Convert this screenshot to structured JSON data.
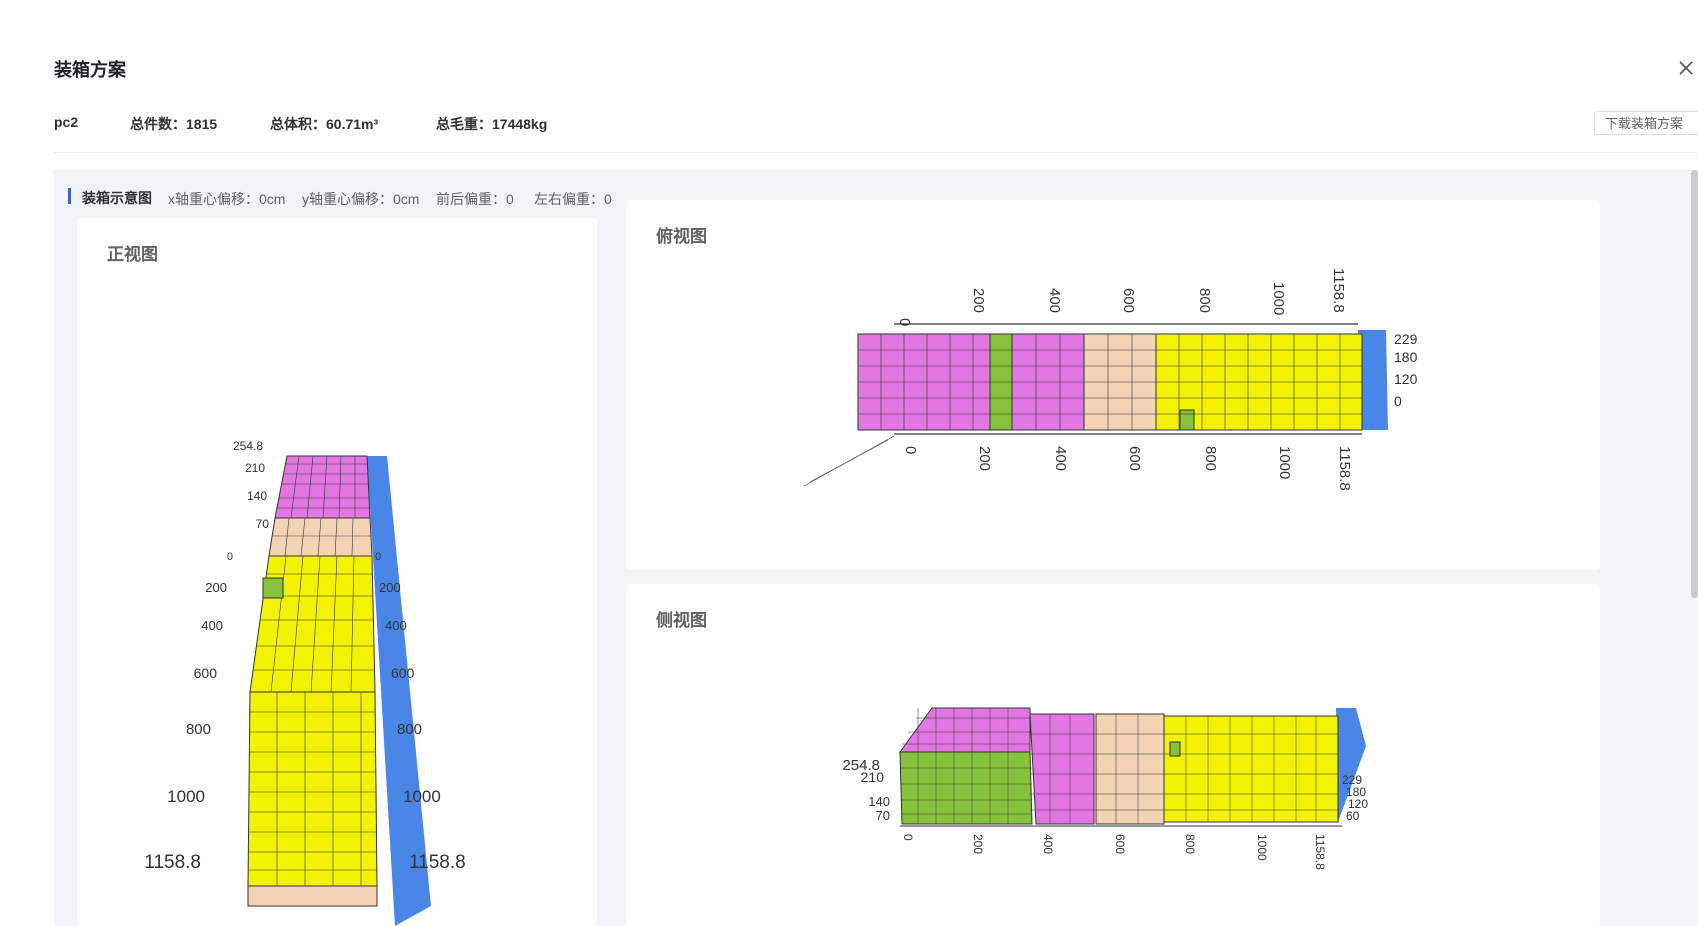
{
  "modal": {
    "title": "装箱方案"
  },
  "summary": {
    "name": "pc2",
    "total_count_label": "总件数：",
    "total_count": "1815",
    "total_volume_label": "总体积：",
    "total_volume": "60.71m³",
    "gross_weight_label": "总毛重：",
    "gross_weight": "17448kg"
  },
  "download_button": "下载装箱方案",
  "section": {
    "title": "装箱示意图",
    "x_offset_label": "x轴重心偏移：",
    "x_offset": "0cm",
    "y_offset_label": "y轴重心偏移：",
    "y_offset": "0cm",
    "fb_label": "前后偏重：",
    "fb_value": "0",
    "lr_label": "左右偏重：",
    "lr_value": "0"
  },
  "views": {
    "front": {
      "title": "正视图"
    },
    "top": {
      "title": "俯视图"
    },
    "side": {
      "title": "侧视图"
    }
  },
  "axes": {
    "length_ticks": [
      "0",
      "200",
      "400",
      "600",
      "800",
      "1000",
      "1158.8"
    ],
    "height_ticks": [
      "254.8",
      "210",
      "140",
      "70",
      "0"
    ],
    "width_ticks": [
      "229",
      "180",
      "120",
      "60",
      "0"
    ]
  },
  "colors": {
    "accent": "#3e64c8",
    "type1_pink": "#e277e2",
    "type2_yellow": "#f3f200",
    "type3_tan": "#f3d3b4",
    "type4_green": "#86c23b",
    "container_blue": "#4a86e8"
  },
  "icons": {
    "close": "close-icon"
  }
}
